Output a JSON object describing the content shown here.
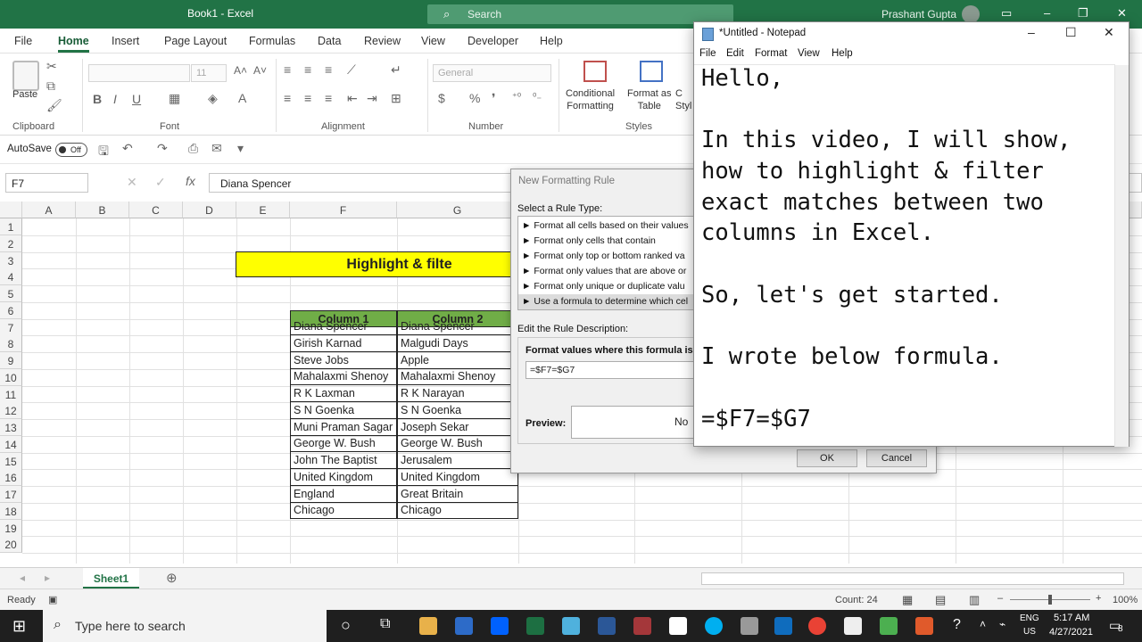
{
  "excel": {
    "title": "Book1  -  Excel",
    "search_placeholder": "Search",
    "user": "Prashant Gupta",
    "tabs": [
      "File",
      "Home",
      "Insert",
      "Page Layout",
      "Formulas",
      "Data",
      "Review",
      "View",
      "Developer",
      "Help"
    ],
    "ribbon": {
      "paste": "Paste",
      "font_size": "11",
      "number_format": "General",
      "conditional_formatting": "Conditional\nFormatting",
      "format_as_table": "Format as\nTable",
      "styles_cut": "C\nStyl",
      "groups": [
        "Clipboard",
        "Font",
        "Alignment",
        "Number",
        "Styles"
      ]
    },
    "qat": {
      "autosave": "AutoSave",
      "toggle": "Off"
    },
    "name_box": "F7",
    "formula_value": "Diana Spencer",
    "columns": [
      "A",
      "B",
      "C",
      "D",
      "E",
      "F",
      "G"
    ],
    "rows": [
      "1",
      "2",
      "3",
      "4",
      "5",
      "6",
      "7",
      "8",
      "9",
      "10",
      "11",
      "12",
      "13",
      "14",
      "15",
      "16",
      "17",
      "18",
      "19",
      "20"
    ],
    "banner": "Highlight & filte",
    "table_headers": [
      "Column 1",
      "Column 2"
    ],
    "table_rows": [
      [
        "Diana Spencer",
        "Diana Spencer"
      ],
      [
        "Girish Karnad",
        "Malgudi Days"
      ],
      [
        "Steve Jobs",
        "Apple"
      ],
      [
        "Mahalaxmi Shenoy",
        "Mahalaxmi Shenoy"
      ],
      [
        "R K Laxman",
        "R K Narayan"
      ],
      [
        "S N Goenka",
        "S N Goenka"
      ],
      [
        "Muni Praman Sagar",
        "Joseph Sekar"
      ],
      [
        "George W. Bush",
        "George W. Bush"
      ],
      [
        "John The Baptist",
        "Jerusalem"
      ],
      [
        "United Kingdom",
        "United Kingdom"
      ],
      [
        "England",
        "Great Britain"
      ],
      [
        "Chicago",
        "Chicago"
      ]
    ],
    "sheet_tab": "Sheet1",
    "status_ready": "Ready",
    "status_count": "Count: 24",
    "zoom": "100%",
    "colors": {
      "accent": "#217346",
      "banner": "#ffff00",
      "header_fill": "#70ad47"
    }
  },
  "dialog": {
    "title": "New Formatting Rule",
    "select_label": "Select a Rule Type:",
    "rules": [
      "Format all cells based on their values",
      "Format only cells that contain",
      "Format only top or bottom ranked va",
      "Format only values that are above or",
      "Format only unique or duplicate valu",
      "Use a formula to determine which cel"
    ],
    "edit_label": "Edit the Rule Description:",
    "formula_label": "Format values where this formula is tru",
    "formula": "=$F7=$G7",
    "preview_label": "Preview:",
    "preview_text": "No",
    "ok": "OK",
    "cancel": "Cancel"
  },
  "notepad": {
    "title": "*Untitled - Notepad",
    "menus": [
      "File",
      "Edit",
      "Format",
      "View",
      "Help"
    ],
    "lines": [
      "Hello,",
      "",
      "In this video, I will show,",
      "how to highlight & filter",
      "exact matches between two",
      "columns in Excel.",
      "",
      "So, let's get started.",
      "",
      "I wrote below formula.",
      "",
      "=$F7=$G7"
    ]
  },
  "taskbar": {
    "search_placeholder": "Type here to search",
    "lang1": "ENG",
    "lang2": "US",
    "time": "5:17 AM",
    "date": "4/27/2021",
    "notif_count": "8"
  }
}
